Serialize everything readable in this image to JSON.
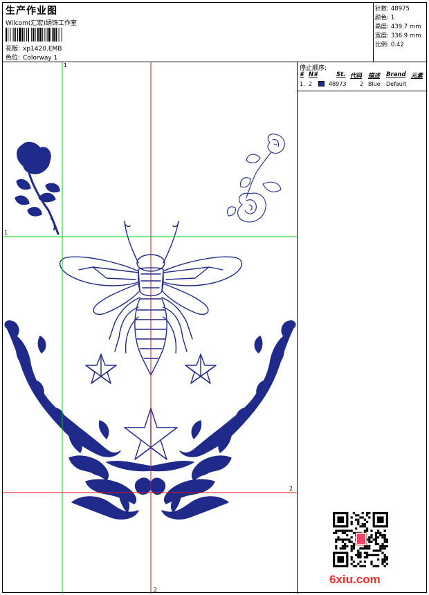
{
  "header": {
    "title": "生产作业图",
    "company": "Wilcom(汇宏)绣饰工作室",
    "design_label": "花版:",
    "design_value": "xp1420.EMB",
    "colorway_label": "色位:",
    "colorway_value": "Colorway 1"
  },
  "stats": [
    {
      "label": "针数:",
      "value": "48975"
    },
    {
      "label": "颜色:",
      "value": "1"
    },
    {
      "label": "高度:",
      "value": "439.7 mm"
    },
    {
      "label": "宽度:",
      "value": "336.9 mm"
    },
    {
      "label": "比例:",
      "value": "0.42"
    }
  ],
  "stops": {
    "title": "停止顺序:",
    "columns": [
      "#",
      "N#",
      "St.",
      "代码",
      "描述",
      "Brand",
      "元素"
    ],
    "rows": [
      {
        "index": "1.",
        "needle": "2",
        "stitches": "48973",
        "code": "2",
        "description": "Blue",
        "brand": "Default",
        "color": "#1a2a8c"
      }
    ]
  },
  "axis_labels": {
    "top_green": "1",
    "left_green": "1",
    "right_red": "2",
    "bottom_red": "2"
  },
  "thread_color": "#1f2a8a",
  "watermark": "6xiu.com"
}
